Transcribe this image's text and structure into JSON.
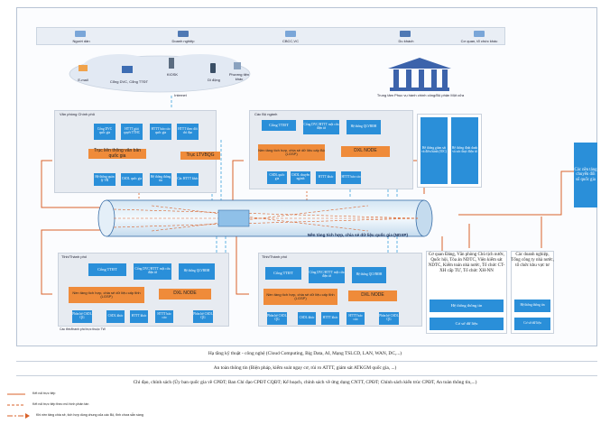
{
  "top_bar": {
    "users": [
      "Người dân",
      "Doanh nghiệp",
      "CBCC,VC",
      "Du khách",
      "Cơ quan, tổ chức khác"
    ]
  },
  "channels": {
    "email": "E-mail",
    "portal": "Cổng DVC, Cổng TTĐT",
    "kiosk": "KIOSK",
    "mobile": "Di động",
    "other": "Phương tiện khác",
    "internet": "Internet"
  },
  "command_center": "Trung tâm Phục vụ hành chính công/Bộ phận Một cửa",
  "office": {
    "title": "Văn phòng Chính phủ",
    "top_boxes": [
      "Cổng DVC quốc gia",
      "HTTT giải quyết TTHC",
      "HTTT báo cáo quốc gia",
      "HTTT theo dõi chỉ đạo"
    ],
    "axis1": "Trục liên thông văn bản quốc gia",
    "axis2": "Trục LTVBQG",
    "bottom_boxes": [
      "Hệ thống quản lý VB",
      "CSDL quốc gia",
      "Hệ thống thông tin",
      "Các HTTT khác"
    ]
  },
  "ministry": {
    "title": "Các Bộ ngành",
    "top_boxes": [
      "Cổng TTĐT",
      "Cổng DVC/HTTT một cửa điện tử",
      "Hệ thống QLVBĐH"
    ],
    "lgsp": "Nền tảng tích hợp, chia sẻ dữ liệu cấp Bộ (LGSP)",
    "node": "DXL NODE",
    "bottom_boxes": [
      "CSDL quốc gia",
      "CSDL chuyên ngành",
      "HTTT khác",
      "HTTT báo cáo"
    ],
    "side_boxes": [
      "Hệ thống giám sát và điều hành (IOC)",
      "Hệ thống định danh và xác thực điện tử"
    ]
  },
  "ndxp": "Nền tảng tích hợp, chia sẻ dữ liệu quốc gia (NDXP)",
  "side_right": "Các nền tảng chuyển đổi số quốc gia",
  "province1": {
    "title": "Tỉnh/Thành phố",
    "top_boxes": [
      "Cổng TTĐT",
      "Cổng DVC/HTTT một cửa điện tử",
      "Hệ thống QLVBĐH"
    ],
    "lgsp": "Nền tảng tích hợp, chia sẻ dữ liệu cấp tỉnh (LGSP)",
    "node": "DXL NODE",
    "bottom_boxes": [
      "Phân hệ CSDL QG",
      "CSDL khác",
      "HTTT khác",
      "HTTT báo cáo",
      "Phân hệ CSDL QG"
    ]
  },
  "province2": {
    "title": "Tỉnh/Thành phố",
    "top_boxes": [
      "Cổng TTĐT",
      "Cổng DVC/HTTT một cửa điện tử",
      "Hệ thống QLVBĐH"
    ],
    "lgsp": "Nền tảng tích hợp, chia sẻ dữ liệu cấp tỉnh (LGSP)",
    "node": "DXL NODE",
    "bottom_boxes": [
      "Phân hệ CSDL QG",
      "CSDL khác",
      "HTTT khác",
      "HTTT báo cáo",
      "Phân hệ CSDL QG"
    ],
    "footnote": "Các tỉnh/thành phố trực thuộc TW"
  },
  "party": {
    "text": "Cơ quan Đảng, Văn phòng Chủ tịch nước, Quốc hội, Tòa án NDTC, Viện kiểm sát NDTC, Kiểm toán nhà nước, Tổ chức CT-XH cấp TƯ, Tổ chức XH-NN",
    "box1": "Hệ thống thông tin",
    "box2": "Cơ sở dữ liệu"
  },
  "enterprise": {
    "text": "Các doanh nghiệp, Tổng công ty nhà nước, tổ chức khu vực tư",
    "box1": "Hệ thống thông tin",
    "box2": "Cơ sở dữ liệu"
  },
  "footer": {
    "line1": "Hạ tầng kỹ thuật - công nghệ (Cloud Computing, Big Data, AI, Mạng TSLCD, LAN, WAN, DC,...)",
    "line2": "An toàn thông tin (Biện pháp, kiểm soát ngay cơ, rủi ro ATTT, giám sát ATKGM quốc gia, ...)",
    "line3": "Chỉ đạo, chính sách (Ủy ban quốc gia về CPĐT; Ban Chỉ đạo CPĐT CQĐT; Kế hoạch, chính sách về ứng dụng CNTT, CPĐT; Chính sách kiến trúc CPĐT, An toàn thông tin,...)"
  },
  "legend": {
    "item1": "Kết nối trực tiếp",
    "item2": "Kết nối trực tiếp theo mô hình phân tán",
    "item3": "Khi nền tảng chia sẻ, tích hợp dùng chung của các Bộ, tỉnh chưa sẵn sàng"
  },
  "colors": {
    "blue": "#1c8ad8",
    "orange": "#ef8b3a",
    "arrow": "#d9622a",
    "dashed": "#3aa0dc"
  }
}
